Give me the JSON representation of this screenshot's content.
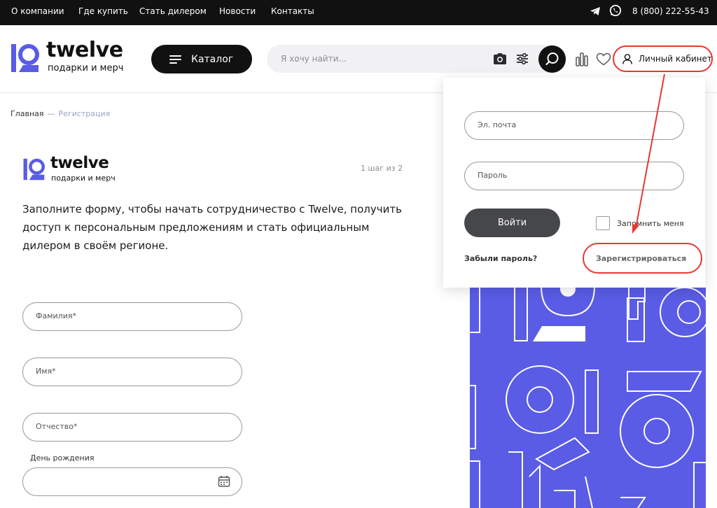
{
  "topbar": {
    "links": [
      "О компании",
      "Где купить",
      "Стать дилером",
      "Новости",
      "Контакты"
    ],
    "phone": "8 (800) 222-55-43",
    "icons": [
      "telegram-icon",
      "whatsapp-icon"
    ]
  },
  "header": {
    "logo_word": "twelve",
    "logo_sub": "подарки и мерч",
    "catalog_label": "Каталог",
    "search_placeholder": "Я хочу найти...",
    "account_label": "Личный кабинет",
    "icons": [
      "camera-icon",
      "filter-icon",
      "search-icon",
      "compare-icon",
      "heart-icon",
      "user-icon"
    ]
  },
  "breadcrumb": {
    "home": "Главная",
    "separator": "—",
    "current": "Регистрация"
  },
  "form": {
    "logo_word": "twelve",
    "logo_sub": "подарки и мерч",
    "step": "1 шаг из 2",
    "intro": "Заполните форму, чтобы начать сотрудничество с Twelve, получить доступ к персональным предложениям и стать официальным дилером в своём регионе.",
    "last_name_placeholder": "Фамилия*",
    "first_name_placeholder": "Имя*",
    "middle_name_placeholder": "Отчество*",
    "birthday_label": "День рождения",
    "birthday_value": ""
  },
  "login_dropdown": {
    "email_placeholder": "Эл. почта",
    "password_placeholder": "Пароль",
    "login_button": "Войти",
    "remember_label": "Запомнить меня",
    "remember_checked": false,
    "forgot_link": "Забыли пароль?",
    "register_link": "Зарегистрироваться"
  },
  "colors": {
    "brand_purple": "#5a5ce6",
    "dark": "#111111",
    "button_gray": "#46474b",
    "annotation_red": "#e53935"
  }
}
